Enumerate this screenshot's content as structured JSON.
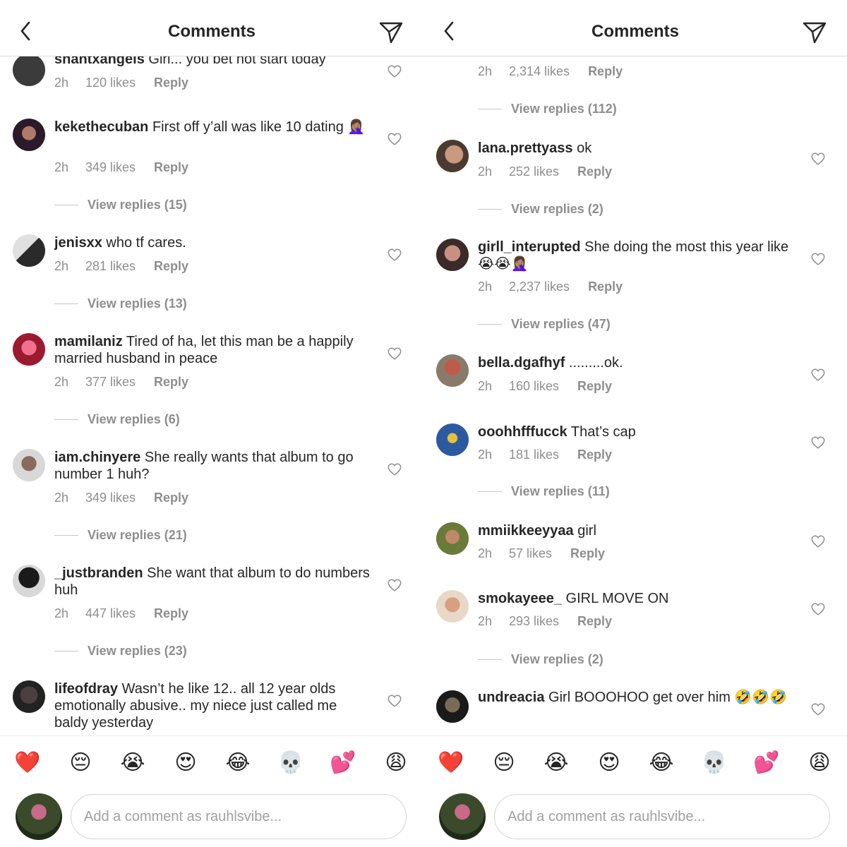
{
  "header": {
    "title": "Comments"
  },
  "left": {
    "comments": [
      {
        "username": "shantxangels",
        "text": "Girl... you bet not start today",
        "time": "2h",
        "likes": "120 likes",
        "reply": "Reply"
      },
      {
        "username": "kekethecuban",
        "text": "First off y’all was like 10 dating 🤦🏽‍♀️",
        "time": "2h",
        "likes": "349 likes",
        "reply": "Reply",
        "view_replies": "View replies (15)"
      },
      {
        "username": "jenisxx",
        "text": "who tf cares.",
        "time": "2h",
        "likes": "281 likes",
        "reply": "Reply",
        "view_replies": "View replies (13)"
      },
      {
        "username": "mamilaniz",
        "text": "Tired of ha, let this man be a happily married husband in peace",
        "time": "2h",
        "likes": "377 likes",
        "reply": "Reply",
        "view_replies": "View replies (6)"
      },
      {
        "username": "iam.chinyere",
        "text": "She really wants that album to go number 1 huh?",
        "time": "2h",
        "likes": "349 likes",
        "reply": "Reply",
        "view_replies": "View replies (21)"
      },
      {
        "username": "_justbranden",
        "text": "She want that album to do numbers huh",
        "time": "2h",
        "likes": "447 likes",
        "reply": "Reply",
        "view_replies": "View replies (23)"
      },
      {
        "username": "lifeofdray",
        "text": "Wasn’t he like 12.. all 12 year olds emotionally abusive.. my niece just called me baldy yesterday"
      }
    ]
  },
  "right": {
    "comments": [
      {
        "time": "2h",
        "likes": "2,314 likes",
        "reply": "Reply",
        "view_replies": "View replies (112)"
      },
      {
        "username": "lana.prettyass",
        "text": "ok",
        "time": "2h",
        "likes": "252 likes",
        "reply": "Reply",
        "view_replies": "View replies (2)"
      },
      {
        "username": "girll_interupted",
        "text": "She doing the most this year like 😭😭🤦🏽‍♀️",
        "time": "2h",
        "likes": "2,237 likes",
        "reply": "Reply",
        "view_replies": "View replies (47)"
      },
      {
        "username": "bella.dgafhyf",
        "text": ".........ok.",
        "time": "2h",
        "likes": "160 likes",
        "reply": "Reply"
      },
      {
        "username": "ooohhfffucck",
        "text": "That’s cap",
        "time": "2h",
        "likes": "181 likes",
        "reply": "Reply",
        "view_replies": "View replies (11)"
      },
      {
        "username": "mmiikkeeyyaa",
        "text": "girl",
        "time": "2h",
        "likes": "57 likes",
        "reply": "Reply"
      },
      {
        "username": "smokayeee_",
        "text": "GIRL MOVE ON",
        "time": "2h",
        "likes": "293 likes",
        "reply": "Reply",
        "view_replies": "View replies (2)"
      },
      {
        "username": "undreacia",
        "text": "Girl BOOOHOO get over him 🤣🤣🤣"
      }
    ]
  },
  "emoji_bar": [
    "❤️",
    "😔",
    "😭",
    "😍",
    "😂",
    "💀",
    "💕",
    "😩"
  ],
  "compose": {
    "placeholder": "Add a comment as rauhlsvibe..."
  },
  "avatar_colors": [
    "#3b3b3b",
    "#5a3a3a",
    "#8a7a7a",
    "#c1304a",
    "#6a5a4a",
    "#1a1a1a",
    "#2a2a2a",
    "#4a4040",
    "#7a5a4a",
    "#8a5a4a",
    "#c05a4a",
    "#2c5aa0",
    "#6a7a3a",
    "#c89a7a",
    "#2a2a2a"
  ]
}
